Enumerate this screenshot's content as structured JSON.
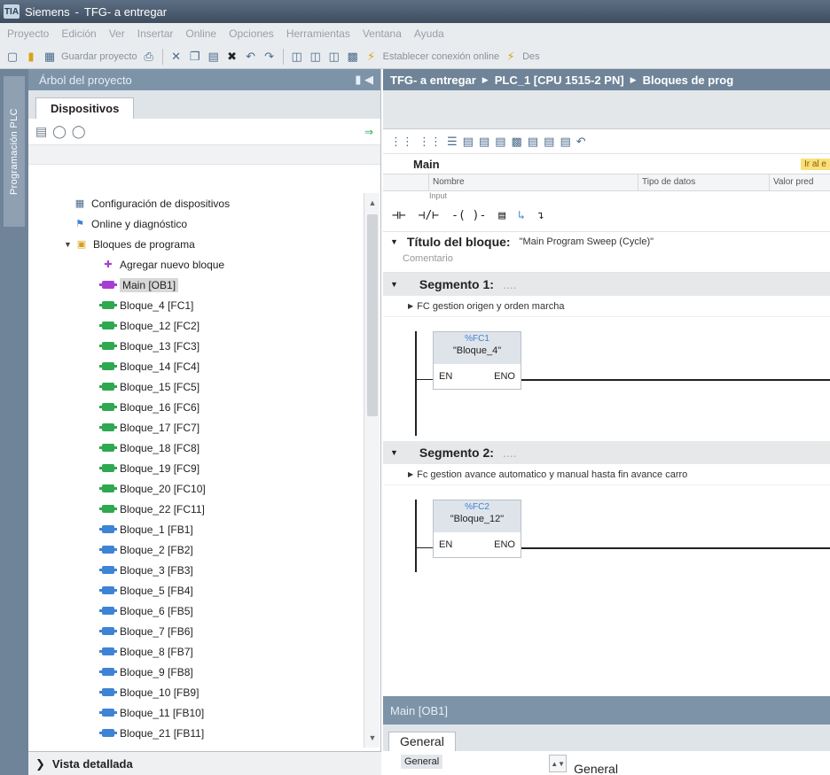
{
  "title": {
    "app": "Siemens",
    "sep": "-",
    "project": "TFG- a entregar"
  },
  "menu": [
    "Proyecto",
    "Edición",
    "Ver",
    "Insertar",
    "Online",
    "Opciones",
    "Herramientas",
    "Ventana",
    "Ayuda"
  ],
  "toolbar": {
    "save_label": "Guardar proyecto",
    "online_label": "Establecer conexión online",
    "offline_label": "Des"
  },
  "left_strip": {
    "label": "Programación PLC"
  },
  "project_tree": {
    "header": "Árbol del proyecto",
    "tab": "Dispositivos",
    "items": [
      {
        "label": "Configuración de dispositivos",
        "icon": "device-config-icon",
        "level": 1
      },
      {
        "label": "Online y diagnóstico",
        "icon": "online-diag-icon",
        "level": 1
      },
      {
        "label": "Bloques de programa",
        "icon": "folder-icon",
        "level": 0,
        "expanded": true
      },
      {
        "label": "Agregar nuevo bloque",
        "icon": "add-block-icon",
        "level": 2
      },
      {
        "label": "Main [OB1]",
        "icon": "ob",
        "level": 2,
        "selected": true
      },
      {
        "label": "Bloque_4 [FC1]",
        "icon": "fc",
        "level": 2
      },
      {
        "label": "Bloque_12 [FC2]",
        "icon": "fc",
        "level": 2
      },
      {
        "label": "Bloque_13 [FC3]",
        "icon": "fc",
        "level": 2
      },
      {
        "label": "Bloque_14 [FC4]",
        "icon": "fc",
        "level": 2
      },
      {
        "label": "Bloque_15 [FC5]",
        "icon": "fc",
        "level": 2
      },
      {
        "label": "Bloque_16 [FC6]",
        "icon": "fc",
        "level": 2
      },
      {
        "label": "Bloque_17 [FC7]",
        "icon": "fc",
        "level": 2
      },
      {
        "label": "Bloque_18 [FC8]",
        "icon": "fc",
        "level": 2
      },
      {
        "label": "Bloque_19 [FC9]",
        "icon": "fc",
        "level": 2
      },
      {
        "label": "Bloque_20 [FC10]",
        "icon": "fc",
        "level": 2
      },
      {
        "label": "Bloque_22 [FC11]",
        "icon": "fc",
        "level": 2
      },
      {
        "label": "Bloque_1 [FB1]",
        "icon": "fb",
        "level": 2
      },
      {
        "label": "Bloque_2 [FB2]",
        "icon": "fb",
        "level": 2
      },
      {
        "label": "Bloque_3 [FB3]",
        "icon": "fb",
        "level": 2
      },
      {
        "label": "Bloque_5 [FB4]",
        "icon": "fb",
        "level": 2
      },
      {
        "label": "Bloque_6 [FB5]",
        "icon": "fb",
        "level": 2
      },
      {
        "label": "Bloque_7 [FB6]",
        "icon": "fb",
        "level": 2
      },
      {
        "label": "Bloque_8 [FB7]",
        "icon": "fb",
        "level": 2
      },
      {
        "label": "Bloque_9 [FB8]",
        "icon": "fb",
        "level": 2
      },
      {
        "label": "Bloque_10 [FB9]",
        "icon": "fb",
        "level": 2
      },
      {
        "label": "Bloque_11 [FB10]",
        "icon": "fb",
        "level": 2
      },
      {
        "label": "Bloque_21 [FB11]",
        "icon": "fb",
        "level": 2
      }
    ],
    "detail_view": "Vista detallada"
  },
  "editor": {
    "breadcrumb": [
      "TFG- a entregar",
      "PLC_1 [CPU 1515-2 PN]",
      "Bloques de prog"
    ],
    "interface_title": "Main",
    "interface_badge": "Ir al e",
    "columns": [
      "Nombre",
      "Tipo de datos",
      "Valor pred"
    ],
    "first_row": "Input",
    "block_title_label": "Título del bloque:",
    "block_title_value": "\"Main Program Sweep (Cycle)\"",
    "comment_placeholder": "Comentario",
    "segments": [
      {
        "title": "Segmento 1:",
        "comment": "FC gestion origen y orden marcha",
        "call_type": "%FC1",
        "call_name": "\"Bloque_4\"",
        "en": "EN",
        "eno": "ENO"
      },
      {
        "title": "Segmento 2:",
        "comment": "Fc gestion avance automatico y manual hasta fin avance carro",
        "call_type": "%FC2",
        "call_name": "\"Bloque_12\"",
        "en": "EN",
        "eno": "ENO"
      }
    ]
  },
  "properties": {
    "header": "Main [OB1]",
    "tab": "General",
    "nav_item": "General",
    "section_title": "General"
  },
  "colors": {
    "fc": "#2fa84f",
    "fb": "#3f84d4",
    "ob": "#a63fd0",
    "accent": "#6f8498"
  }
}
